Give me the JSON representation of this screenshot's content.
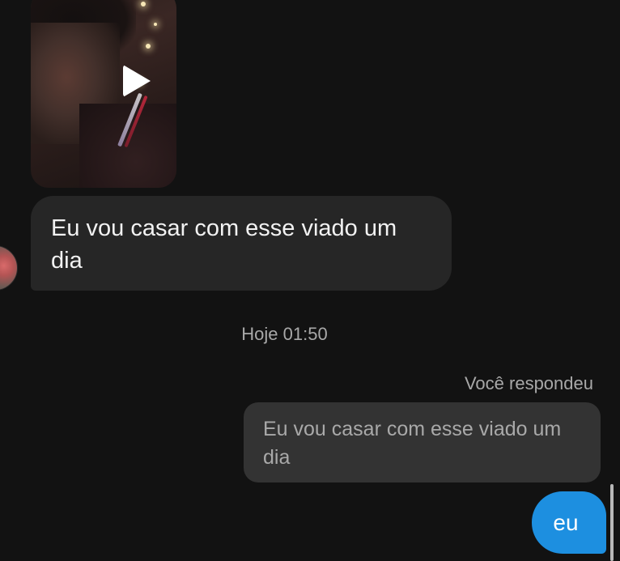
{
  "thread": {
    "received_message": "Eu vou casar com esse viado um dia",
    "timestamp": "Hoje 01:50",
    "replied_label": "Você respondeu",
    "quoted_message": "Eu vou casar com esse viado um dia",
    "sent_message": "eu"
  },
  "icons": {
    "play": "play-icon"
  },
  "colors": {
    "background": "#121212",
    "received_bubble": "#262626",
    "quoted_bubble": "#333333",
    "sent_bubble": "#1d8fe0",
    "secondary_text": "#a8a8a8"
  }
}
